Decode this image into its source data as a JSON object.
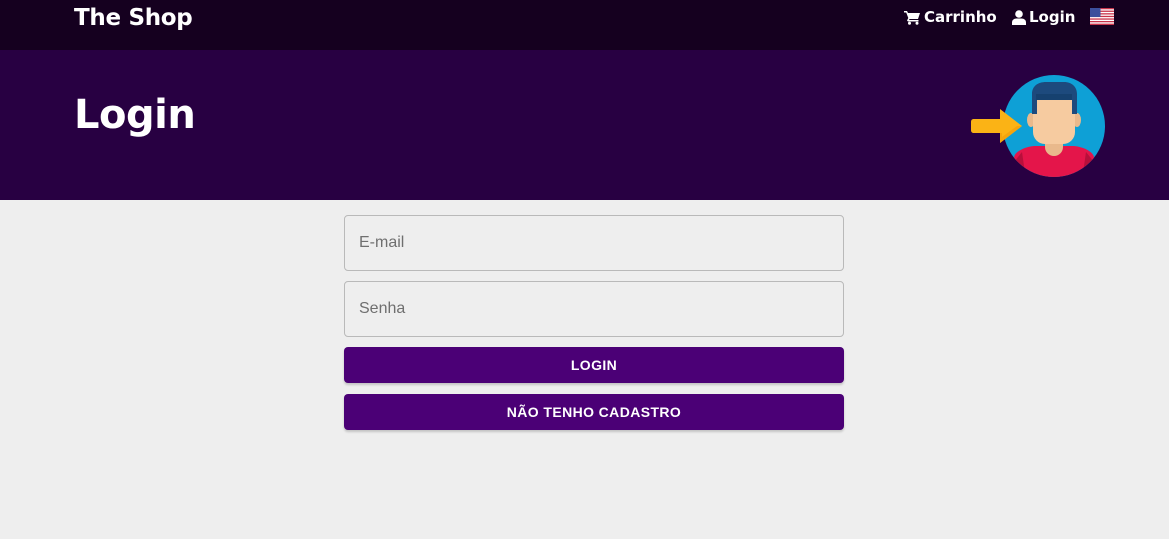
{
  "navbar": {
    "brand": "The Shop",
    "cart_label": "Carrinho",
    "cart_icon": "cart-icon",
    "login_label": "Login",
    "login_icon": "user-icon",
    "language_icon": "us-flag-icon"
  },
  "hero": {
    "title": "Login",
    "illustration": "user-login-illustration"
  },
  "form": {
    "email_placeholder": "E-mail",
    "email_value": "",
    "password_placeholder": "Senha",
    "password_value": "",
    "login_button": "LOGIN",
    "register_button": "NÃO TENHO CADASTRO"
  },
  "colors": {
    "navbar_bg": "#15001f",
    "hero_bg": "#280042",
    "button_bg": "#4b0076",
    "page_bg": "#eeeeee"
  }
}
